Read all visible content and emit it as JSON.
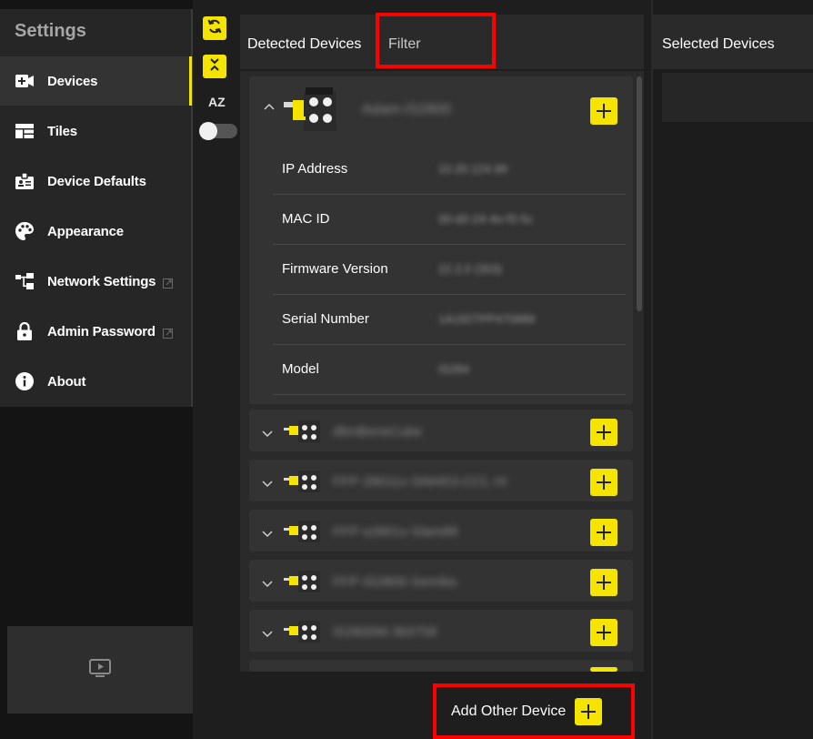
{
  "sidebar": {
    "title": "Settings",
    "items": [
      {
        "label": "Devices",
        "icon": "camera-plus-icon",
        "active": true,
        "external": false
      },
      {
        "label": "Tiles",
        "icon": "tiles-icon",
        "active": false,
        "external": false
      },
      {
        "label": "Device Defaults",
        "icon": "badge-icon",
        "active": false,
        "external": false
      },
      {
        "label": "Appearance",
        "icon": "palette-icon",
        "active": false,
        "external": false
      },
      {
        "label": "Network Settings",
        "icon": "network-icon",
        "active": false,
        "external": true
      },
      {
        "label": "Admin Password",
        "icon": "lock-icon",
        "active": false,
        "external": true
      },
      {
        "label": "About",
        "icon": "info-icon",
        "active": false,
        "external": false
      }
    ],
    "bottom_icon": "slideshow-icon"
  },
  "toolbar": {
    "sort_label": "AZ",
    "refresh_icon": "refresh-icon",
    "collapse_icon": "collapse-all-icon",
    "sort_toggle_on": false
  },
  "detected": {
    "title": "Detected Devices",
    "filter_placeholder": "Filter",
    "expanded_device": {
      "name": "Adam-IS2800",
      "fields": [
        {
          "key": "IP Address",
          "value": "10.20.124.99"
        },
        {
          "key": "MAC ID",
          "value": "00-d0-24-4e-f3-5c"
        },
        {
          "key": "Firmware Version",
          "value": "22.2.0 (303)"
        },
        {
          "key": "Serial Number",
          "value": "1A192TPP470889"
        },
        {
          "key": "Model",
          "value": "IS284"
        }
      ]
    },
    "devices": [
      {
        "name": "dlimBeneCube"
      },
      {
        "name": "FFP-28011v-SIM453-CCL-IX"
      },
      {
        "name": "FFP-s2801v-Slam89"
      },
      {
        "name": "FFP-IS2800-SemIbs"
      },
      {
        "name": "IS2800M-3k9758"
      }
    ],
    "add_other_label": "Add Other Device"
  },
  "selected": {
    "title": "Selected Devices"
  },
  "colors": {
    "accent": "#f5e400",
    "highlight": "#ff0000"
  }
}
